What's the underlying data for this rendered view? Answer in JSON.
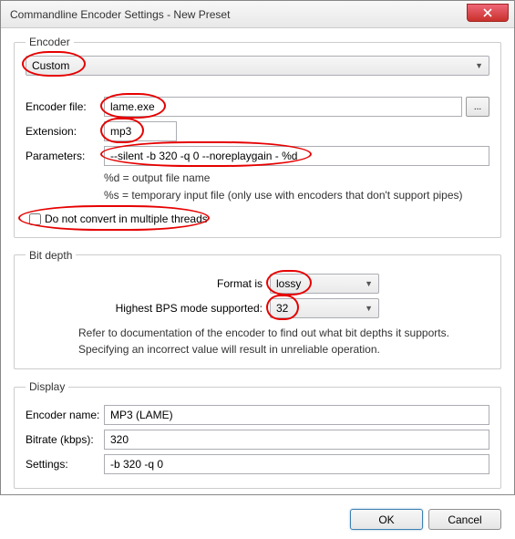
{
  "window": {
    "title": "Commandline Encoder Settings - New Preset"
  },
  "encoder_group": {
    "legend": "Encoder",
    "preset_select": "Custom",
    "encoder_file_label": "Encoder file:",
    "encoder_file_value": "lame.exe",
    "browse_label": "...",
    "extension_label": "Extension:",
    "extension_value": "mp3",
    "parameters_label": "Parameters:",
    "parameters_value": "--silent -b 320 -q 0 --noreplaygain - %d",
    "hint1": "%d = output file name",
    "hint2": "%s = temporary input file (only use with encoders that don't support pipes)",
    "checkbox_label": "Do not convert in multiple threads"
  },
  "bitdepth_group": {
    "legend": "Bit depth",
    "format_label": "Format is",
    "format_value": "lossy",
    "bps_label": "Highest BPS mode supported:",
    "bps_value": "32",
    "note1": "Refer to documentation of the encoder to find out what bit depths it supports.",
    "note2": "Specifying an incorrect value will result in unreliable operation."
  },
  "display_group": {
    "legend": "Display",
    "encoder_name_label": "Encoder name:",
    "encoder_name_value": "MP3 (LAME)",
    "bitrate_label": "Bitrate (kbps):",
    "bitrate_value": "320",
    "settings_label": "Settings:",
    "settings_value": "-b 320 -q 0"
  },
  "buttons": {
    "ok": "OK",
    "cancel": "Cancel"
  }
}
